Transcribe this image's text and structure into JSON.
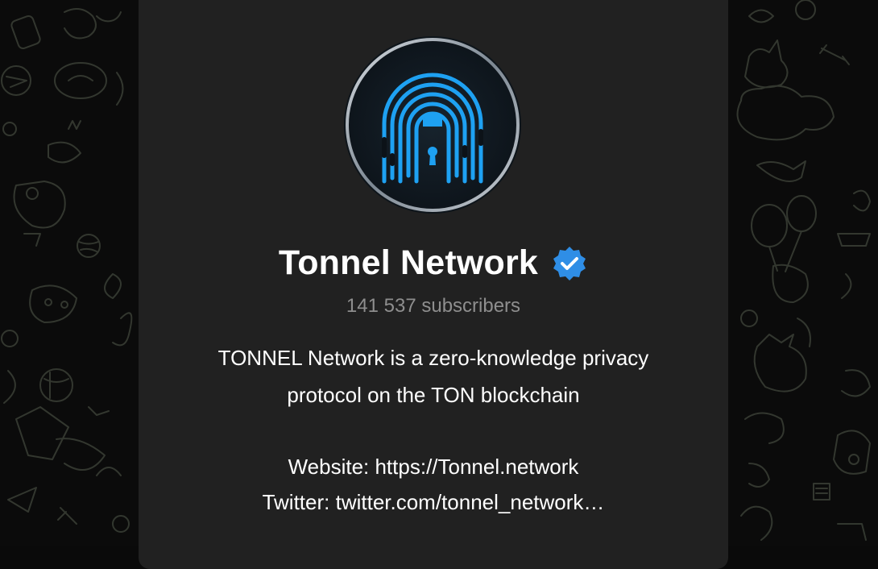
{
  "channel": {
    "title": "Tonnel Network",
    "verified_icon": "verified-badge-icon",
    "subscribers": "141 537 subscribers",
    "description_lines": [
      "TONNEL Network is a zero-knowledge privacy",
      "protocol on the TON blockchain"
    ],
    "website": "Website: https://Tonnel.network",
    "twitter": "Twitter: twitter.com/tonnel_network…"
  },
  "colors": {
    "card_bg": "#212121",
    "page_bg": "#0b0b0b",
    "accent_blue": "#1ea1f2",
    "verified_blue": "#2f8ee6",
    "subtitle_gray": "#8e8e8e"
  },
  "icons": {
    "avatar": "fingerprint-keyhole-logo",
    "background": "doodle-pattern"
  }
}
